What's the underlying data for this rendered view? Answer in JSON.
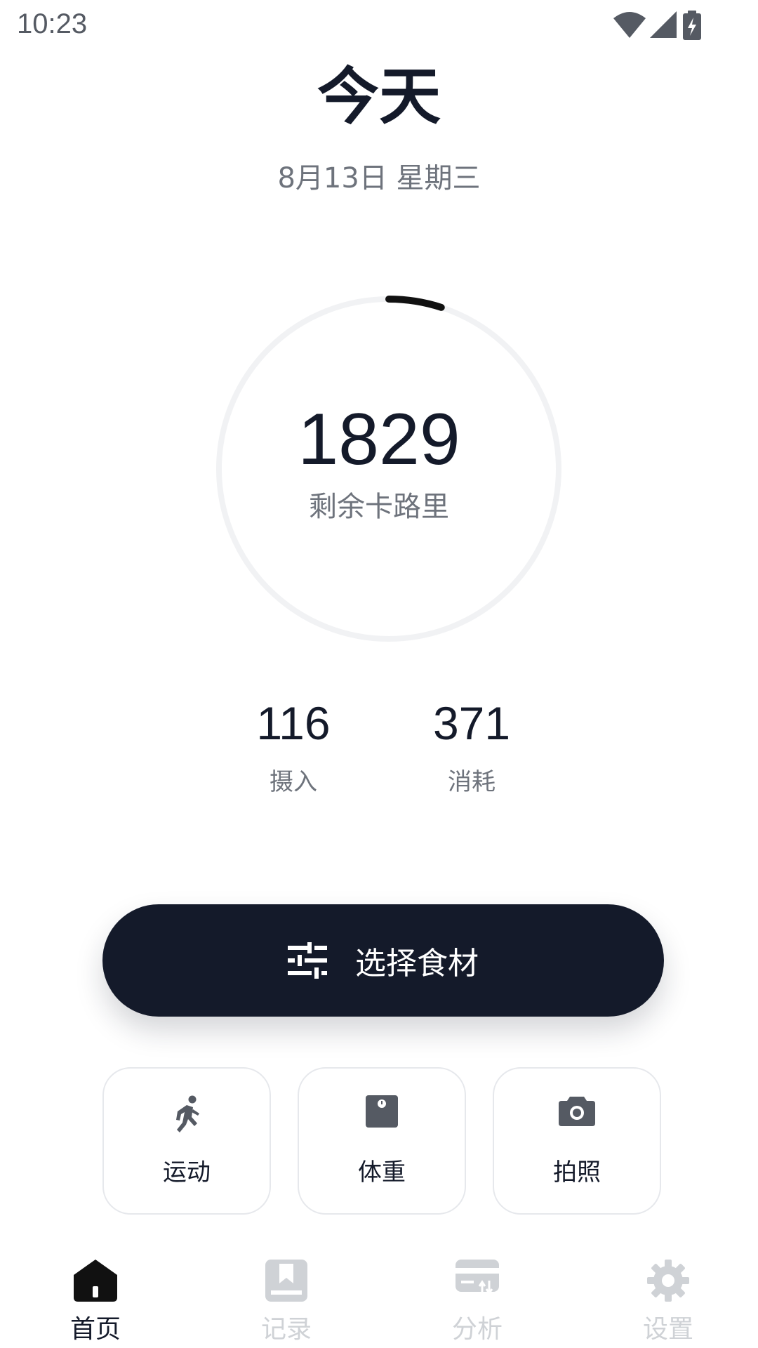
{
  "status_bar": {
    "time": "10:23"
  },
  "header": {
    "title": "今天",
    "date": "8月13日 星期三"
  },
  "calorie_ring": {
    "remaining_value": "1829",
    "remaining_label": "剩余卡路里",
    "progress": 0.05
  },
  "stats": {
    "intake_value": "116",
    "intake_label": "摄入",
    "burned_value": "371",
    "burned_label": "消耗"
  },
  "primary_action": {
    "label": "选择食材",
    "icon": "tune-icon"
  },
  "quick_actions": [
    {
      "label": "运动",
      "icon": "run-icon"
    },
    {
      "label": "体重",
      "icon": "scale-icon"
    },
    {
      "label": "拍照",
      "icon": "camera-icon"
    }
  ],
  "bottom_nav": [
    {
      "label": "首页",
      "icon": "home-icon",
      "active": true
    },
    {
      "label": "记录",
      "icon": "book-icon",
      "active": false
    },
    {
      "label": "分析",
      "icon": "wallet-icon",
      "active": false
    },
    {
      "label": "设置",
      "icon": "gear-icon",
      "active": false
    }
  ],
  "colors": {
    "primary": "#141a2a",
    "muted_text": "#6e737c",
    "inactive_nav": "#cfd2d6",
    "ring_track": "#f1f2f4"
  }
}
